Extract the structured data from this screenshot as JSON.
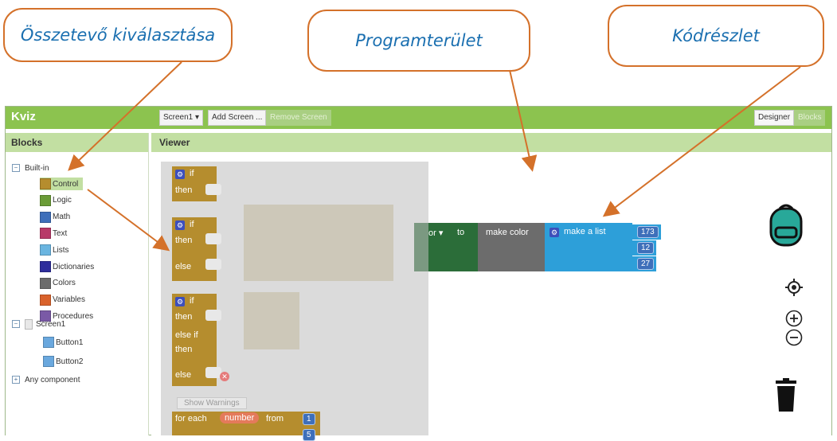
{
  "callouts": {
    "component_select": "Összetevő kiválasztása",
    "program_area": "Programterület",
    "code_snippet": "Kódrészlet"
  },
  "app": {
    "title": "Kviz"
  },
  "toolbar": {
    "screen_select": "Screen1 ▾",
    "add_screen": "Add Screen ...",
    "remove_screen": "Remove Screen",
    "designer": "Designer",
    "blocks": "Blocks"
  },
  "blocks_panel": {
    "title": "Blocks",
    "builtin_label": "Built-in",
    "builtin_items": [
      {
        "label": "Control",
        "color": "#b58d2e"
      },
      {
        "label": "Logic",
        "color": "#6a9c36"
      },
      {
        "label": "Math",
        "color": "#3e6fba"
      },
      {
        "label": "Text",
        "color": "#b83968"
      },
      {
        "label": "Lists",
        "color": "#6ab5e0"
      },
      {
        "label": "Dictionaries",
        "color": "#2e2d9c"
      },
      {
        "label": "Colors",
        "color": "#6c6c6c"
      },
      {
        "label": "Variables",
        "color": "#d9622b"
      },
      {
        "label": "Procedures",
        "color": "#7a5aa6"
      }
    ],
    "screen_label": "Screen1",
    "screen_items": [
      "Button1",
      "Button2"
    ],
    "any_component": "Any component"
  },
  "viewer": {
    "title": "Viewer",
    "flyout": {
      "if": "if",
      "then": "then",
      "else": "else",
      "else_if": "else if",
      "show_warnings": "Show Warnings",
      "for_each": "for each",
      "number_var": "number",
      "from": "from",
      "from_value": "1",
      "to_value": "5"
    },
    "code": {
      "setter_suffix": "or ▾",
      "to": "to",
      "make_color": "make color",
      "make_a_list": "make a list",
      "values": [
        "173",
        "12",
        "27"
      ]
    }
  },
  "colors": {
    "topbar": "#8cc34f",
    "panel_header": "#c2dfa2",
    "callout_border": "#d4712a",
    "callout_text": "#1a6fb0",
    "control_gold": "#b58d2e",
    "color_gray": "#6c6c6c",
    "list_blue": "#2d9fd9",
    "setter_green": "#2b6d39",
    "math_blue": "#3e6fba",
    "backpack_teal": "#28a899"
  },
  "icons": [
    "backpack-icon",
    "target-icon",
    "zoom-in-icon",
    "zoom-out-icon",
    "trash-icon",
    "gear-icon"
  ]
}
